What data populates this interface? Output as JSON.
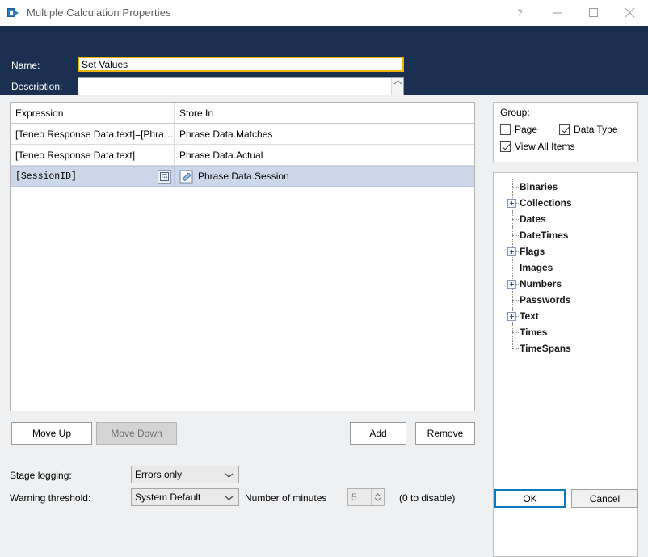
{
  "window": {
    "title": "Multiple Calculation Properties",
    "icon": "app-icon",
    "controls": {
      "help": "?",
      "minimize": "minimize-icon",
      "maximize": "maximize-icon",
      "close": "close-icon"
    }
  },
  "header": {
    "name_label": "Name:",
    "name_value": "Set Values",
    "description_label": "Description:",
    "description_value": ""
  },
  "grid": {
    "columns": [
      "Expression",
      "Store In"
    ],
    "rows": [
      {
        "expression": "[Teneo  Response  Data.text]=[Phrase…",
        "store_in": "Phrase Data.Matches",
        "selected": false,
        "has_calc_button": false,
        "has_store_icon": false
      },
      {
        "expression": "[Teneo Response Data.text]",
        "store_in": "Phrase Data.Actual",
        "selected": false,
        "has_calc_button": false,
        "has_store_icon": false
      },
      {
        "expression": "[SessionID]",
        "store_in": "Phrase Data.Session",
        "selected": true,
        "has_calc_button": true,
        "has_store_icon": true
      }
    ]
  },
  "actions": {
    "move_up": "Move Up",
    "move_down": "Move Down",
    "add": "Add",
    "remove": "Remove"
  },
  "settings": {
    "stage_logging_label": "Stage logging:",
    "stage_logging_value": "Errors only",
    "warning_threshold_label": "Warning threshold:",
    "warning_threshold_value": "System Default",
    "number_of_minutes_label": "Number of minutes",
    "number_of_minutes_value": "5",
    "disable_hint": "(0 to disable)"
  },
  "group": {
    "title": "Group:",
    "page_label": "Page",
    "page_checked": false,
    "data_type_label": "Data Type",
    "data_type_checked": true,
    "view_all_label": "View All Items",
    "view_all_checked": true
  },
  "tree": {
    "items": [
      {
        "label": "Binaries",
        "expandable": false
      },
      {
        "label": "Collections",
        "expandable": true
      },
      {
        "label": "Dates",
        "expandable": false
      },
      {
        "label": "DateTimes",
        "expandable": false
      },
      {
        "label": "Flags",
        "expandable": true
      },
      {
        "label": "Images",
        "expandable": false
      },
      {
        "label": "Numbers",
        "expandable": true
      },
      {
        "label": "Passwords",
        "expandable": false
      },
      {
        "label": "Text",
        "expandable": true
      },
      {
        "label": "Times",
        "expandable": false
      },
      {
        "label": "TimeSpans",
        "expandable": false
      }
    ]
  },
  "dialog_buttons": {
    "ok": "OK",
    "cancel": "Cancel"
  },
  "colors": {
    "header_bg": "#1b3050",
    "name_field_border": "#f0b400",
    "selection": "#ccd8ea",
    "focus_border": "#0d7ac0"
  }
}
